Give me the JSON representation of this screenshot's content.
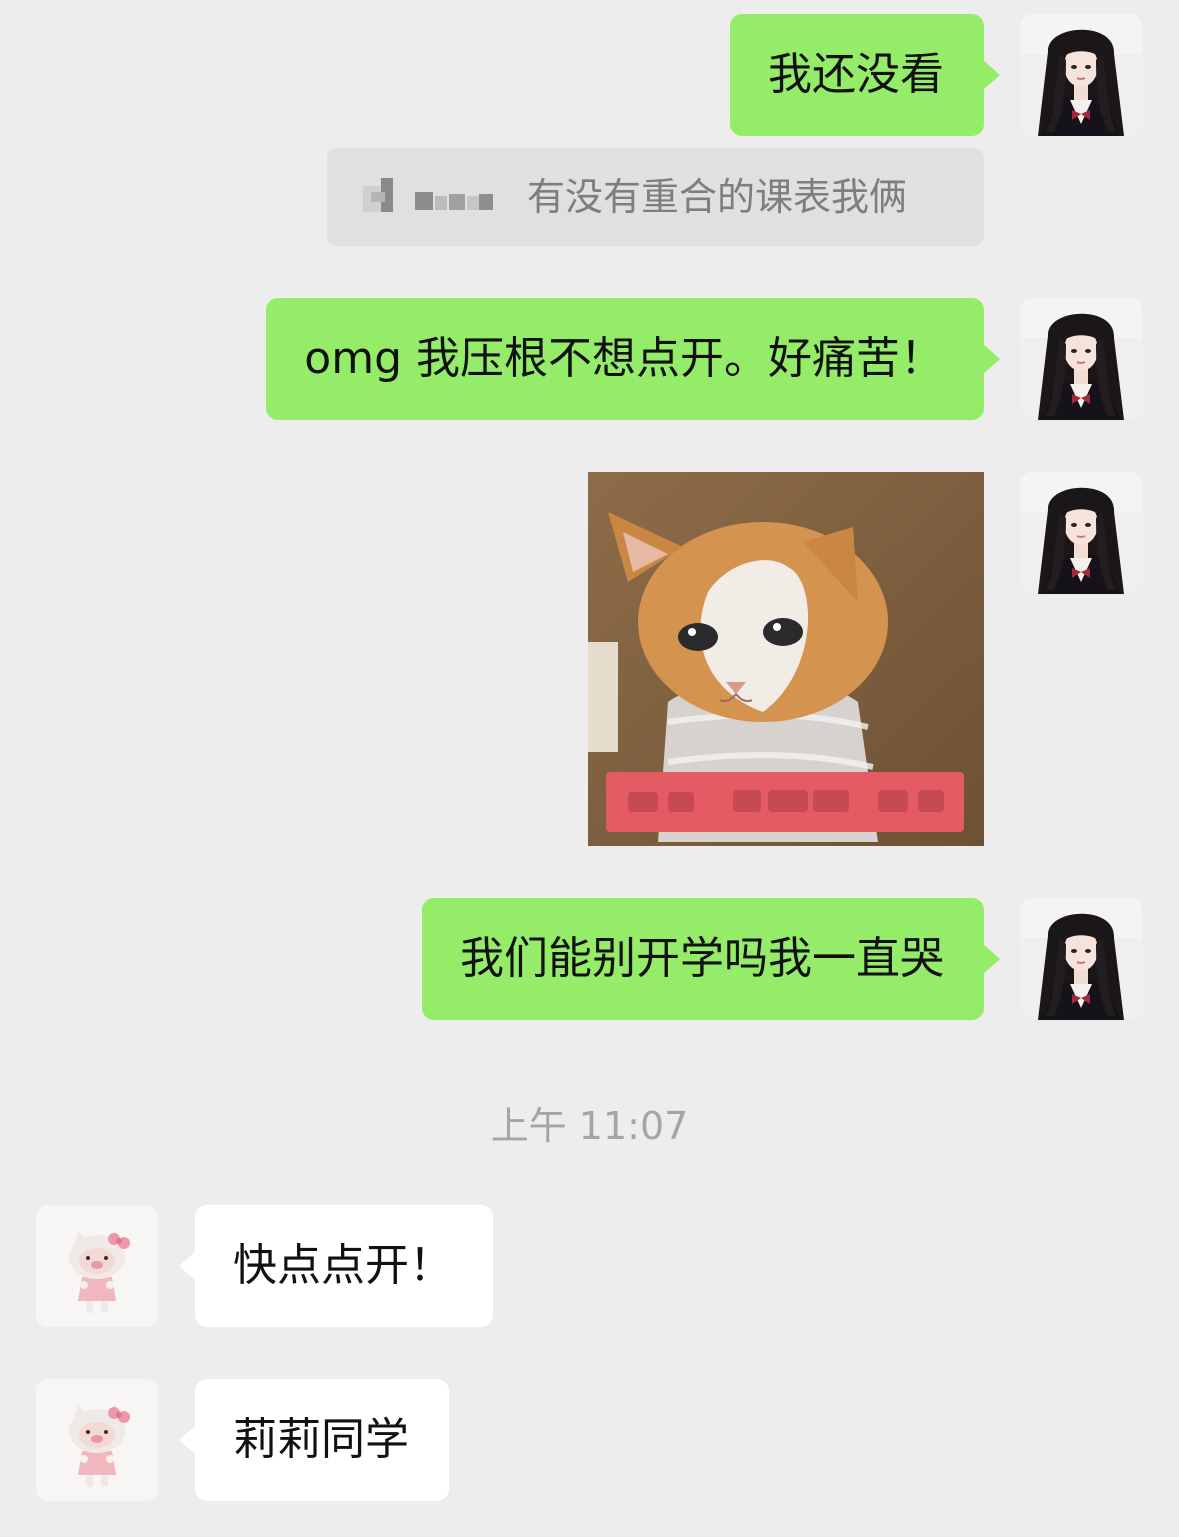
{
  "messages": {
    "m1": "我还没看",
    "quote_text": "有没有重合的课表我俩",
    "m2": "omg 我压根不想点开。好痛苦！",
    "m3": "我们能别开学吗我一直哭",
    "timestamp": "上午 11:07",
    "m4": "快点点开！",
    "m5": "莉莉同学"
  },
  "sticker": {
    "type": "kitten-meme-image",
    "caption_visible": false
  },
  "avatars": {
    "self": "girl-portrait-avatar",
    "peer": "hello-kitty-pig-avatar"
  },
  "colors": {
    "background": "#ededed",
    "self_bubble": "#95ec69",
    "peer_bubble": "#ffffff",
    "quote_bg": "#e0e0e0",
    "timestamp_text": "#a5a5a5"
  }
}
